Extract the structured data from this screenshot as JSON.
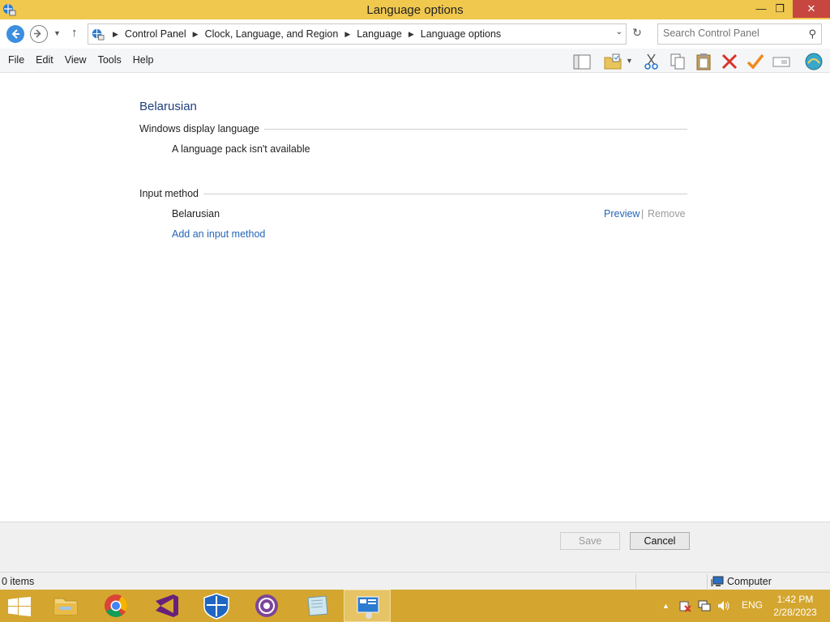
{
  "window": {
    "title": "Language options"
  },
  "address": {
    "breadcrumbs": [
      "Control Panel",
      "Clock, Language, and Region",
      "Language",
      "Language options"
    ]
  },
  "search": {
    "placeholder": "Search Control Panel"
  },
  "menu": {
    "items": [
      "File",
      "Edit",
      "View",
      "Tools",
      "Help"
    ]
  },
  "content": {
    "language_name": "Belarusian",
    "display_section": {
      "heading": "Windows display language",
      "status": "A language pack isn't available"
    },
    "input_section": {
      "heading": "Input method",
      "method_name": "Belarusian",
      "preview_link": "Preview",
      "separator": "|",
      "remove_link": "Remove",
      "add_link": "Add an input method"
    }
  },
  "buttons": {
    "save": "Save",
    "cancel": "Cancel"
  },
  "statusbar": {
    "items_count": "0 items",
    "zone": "Computer"
  },
  "taskbar": {
    "tray_language": "ENG",
    "time": "1:42 PM",
    "date": "2/28/2023",
    "apps": [
      "file-explorer",
      "chrome",
      "visual-studio",
      "windows-defender",
      "tor-browser",
      "notepad",
      "control-panel"
    ]
  },
  "colors": {
    "titlebar": "#f0c84e",
    "taskbar": "#d4a62f",
    "link": "#2566b8",
    "heading": "#1e3f7e"
  }
}
